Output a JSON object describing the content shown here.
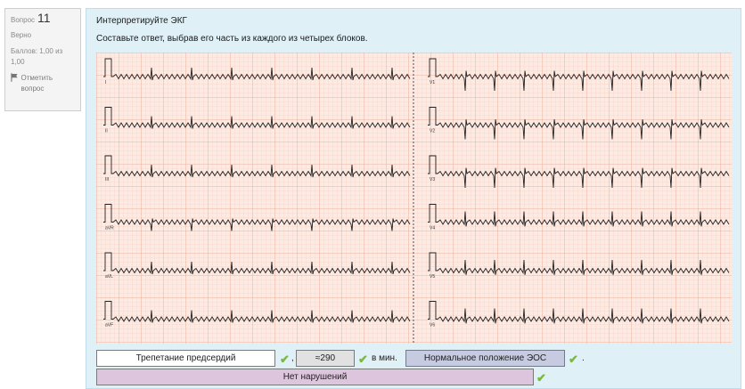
{
  "question_info": {
    "label": "Вопрос",
    "number": "11",
    "status": "Верно",
    "marks": "Баллов: 1,00 из 1,00",
    "flag_label": "Отметить вопрос"
  },
  "question": {
    "title": "Интерпретируйте ЭКГ",
    "instruction": "Составьте ответ, выбрав его часть из каждого из четырех блоков."
  },
  "ecg": {
    "left_leads": [
      "I",
      "II",
      "III",
      "aVR",
      "aVL",
      "aVF"
    ],
    "right_leads": [
      "V1",
      "V2",
      "V3",
      "V4",
      "V5",
      "V6"
    ]
  },
  "answers": {
    "rhythm": "Трепетание предсердий",
    "rate": "≈290",
    "rate_unit": "в мин.",
    "axis": "Нормальное положение  ЭОС",
    "conduction": "Нет нарушений",
    "sep_comma": ",",
    "sep_period": "."
  },
  "colors": {
    "correct_check": "#7ab83b",
    "grid_paper": "#fdeae3",
    "content_bg": "#e0f0f7"
  }
}
